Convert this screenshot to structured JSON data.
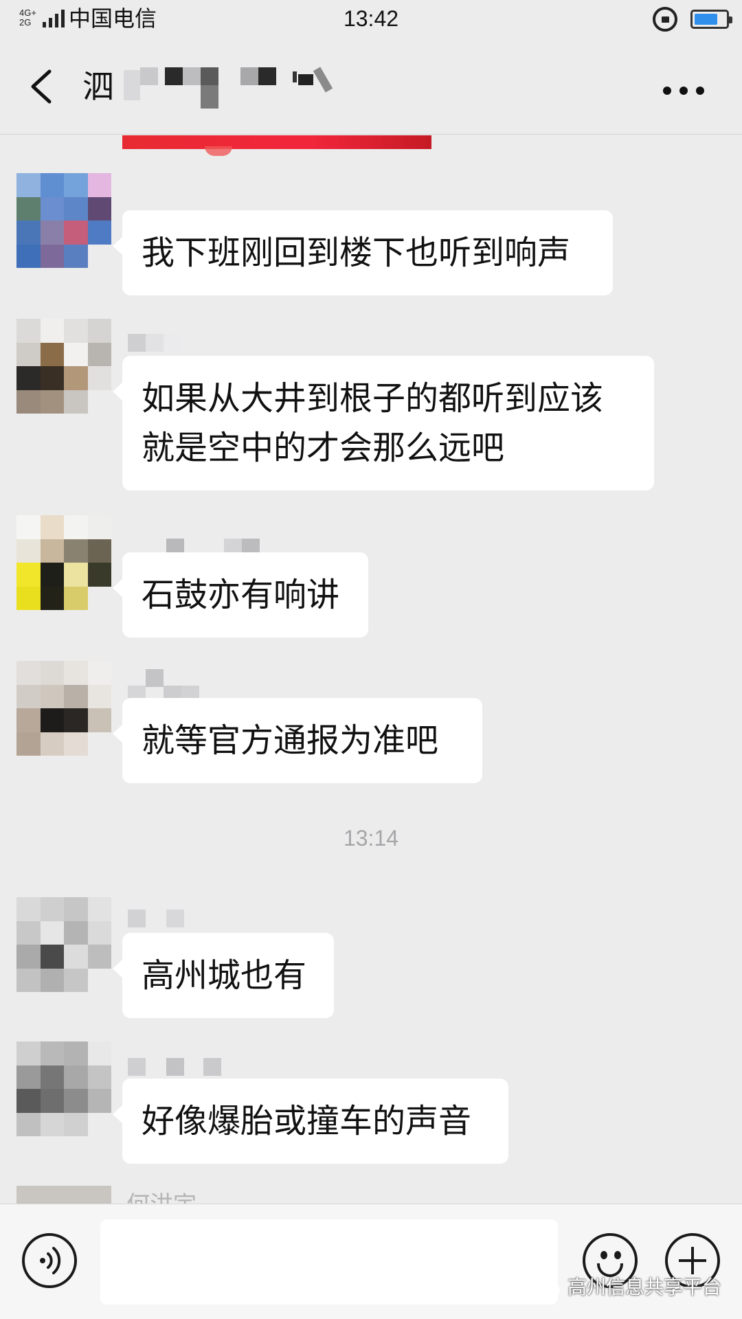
{
  "status_bar": {
    "network_top": "4G+",
    "network_bottom": "2G",
    "carrier": "中国电信",
    "time": "13:42",
    "battery_level": 0.75
  },
  "nav": {
    "title_visible": "泗"
  },
  "messages": [
    {
      "text": "我下班刚回到楼下也听到响声"
    },
    {
      "text": "如果从大井到根子的都听到应该就是空中的才会那么远吧"
    },
    {
      "text": "石鼓亦有响讲"
    },
    {
      "text": "就等官方通报为准吧"
    },
    {
      "text": "高州城也有"
    },
    {
      "text": "好像爆胎或撞车的声音"
    }
  ],
  "timestamp": "13:14",
  "partial_sender": "何洪宇",
  "watermark": "高州信息共享平台",
  "colors": {
    "background": "#ececed",
    "bubble": "#ffffff",
    "battery": "#2f8fea",
    "banner": "#e72a32"
  }
}
